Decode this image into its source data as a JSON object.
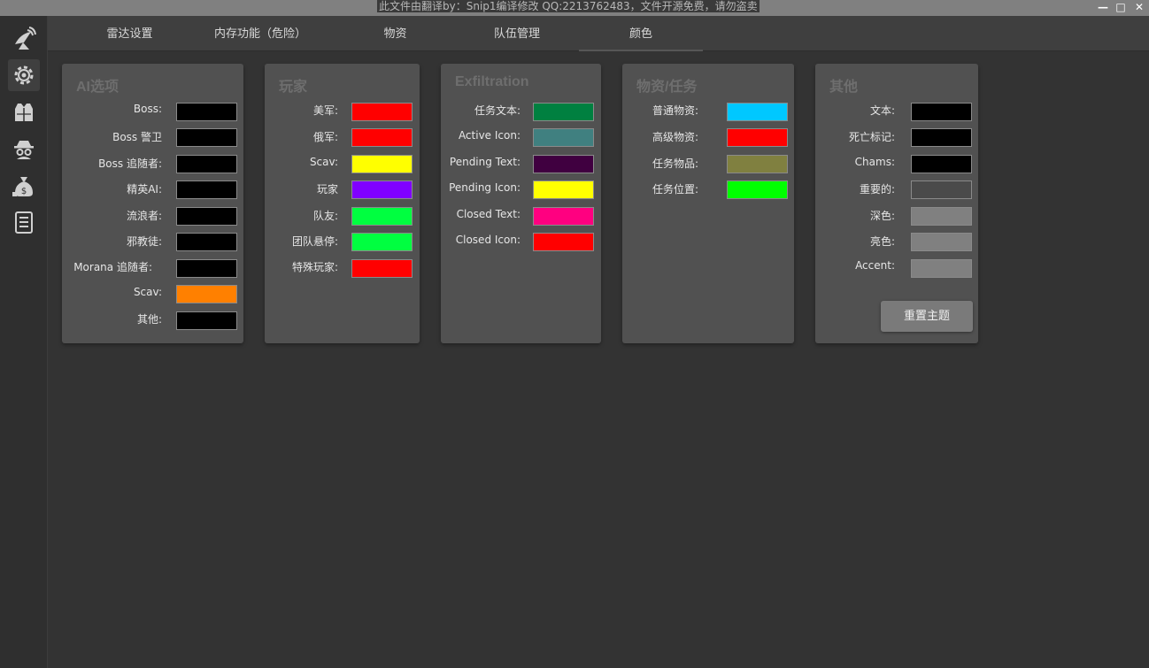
{
  "window": {
    "title": "此文件由翻译by：Snip1编译修改 QQ:2213762483，文件开源免费，请勿盗卖",
    "minimize": "—",
    "maximize": "□",
    "close": "✕"
  },
  "sidebar": {
    "items": [
      {
        "icon": "radar-dish-icon"
      },
      {
        "icon": "gear-icon",
        "active": true
      },
      {
        "icon": "armor-vest-icon"
      },
      {
        "icon": "spy-icon"
      },
      {
        "icon": "money-bags-icon"
      },
      {
        "icon": "notes-icon"
      }
    ]
  },
  "tabs": [
    {
      "label": "雷达设置"
    },
    {
      "label": "内存功能（危险）"
    },
    {
      "label": "物资"
    },
    {
      "label": "队伍管理"
    },
    {
      "label": "颜色",
      "active": true
    }
  ],
  "panels": {
    "ai": {
      "title": "AI选项",
      "rows": [
        {
          "label": "Boss:",
          "color": "#000000"
        },
        {
          "label": "Boss 警卫",
          "color": "#000000"
        },
        {
          "label": "Boss 追随者:",
          "color": "#000000"
        },
        {
          "label": "精英AI:",
          "color": "#000000"
        },
        {
          "label": "流浪者:",
          "color": "#000000"
        },
        {
          "label": "邪教徒:",
          "color": "#000000"
        },
        {
          "label": "Morana 追随者:",
          "color": "#000000"
        },
        {
          "label": "Scav:",
          "color": "#ff8000"
        },
        {
          "label": "其他:",
          "color": "#000000"
        }
      ]
    },
    "players": {
      "title": "玩家",
      "rows": [
        {
          "label": "美军:",
          "color": "#ff0000"
        },
        {
          "label": "俄军:",
          "color": "#ff0000"
        },
        {
          "label": "Scav:",
          "color": "#ffff00"
        },
        {
          "label": "玩家",
          "color": "#8000ff"
        },
        {
          "label": "队友:",
          "color": "#00ff40"
        },
        {
          "label": "团队悬停:",
          "color": "#00ff40"
        },
        {
          "label": "特殊玩家:",
          "color": "#ff0000"
        }
      ]
    },
    "exfil": {
      "title": "Exfiltration",
      "rows": [
        {
          "label": "任务文本:",
          "color": "#008040"
        },
        {
          "label": "Active Icon:",
          "color": "#408080"
        },
        {
          "label": "Pending Text:",
          "color": "#400040"
        },
        {
          "label": "Pending Icon:",
          "color": "#ffff00"
        },
        {
          "label": "Closed Text:",
          "color": "#ff0080"
        },
        {
          "label": "Closed Icon:",
          "color": "#ff0000"
        }
      ]
    },
    "loot": {
      "title": "物资/任务",
      "rows": [
        {
          "label": "普通物资:",
          "color": "#00c8ff"
        },
        {
          "label": "高级物资:",
          "color": "#ff0000"
        },
        {
          "label": "任务物品:",
          "color": "#808040"
        },
        {
          "label": "任务位置:",
          "color": "#00ff00"
        }
      ]
    },
    "other": {
      "title": "其他",
      "rows": [
        {
          "label": "文本:",
          "color": "#000000"
        },
        {
          "label": "死亡标记:",
          "color": "#000000"
        },
        {
          "label": "Chams:",
          "color": "#000000"
        },
        {
          "label": "重要的:",
          "color": "#4a4a4a"
        },
        {
          "label": "深色:",
          "color": "#808080"
        },
        {
          "label": "亮色:",
          "color": "#808080"
        },
        {
          "label": "Accent:",
          "color": "#808080"
        }
      ],
      "reset_label": "重置主题"
    }
  }
}
